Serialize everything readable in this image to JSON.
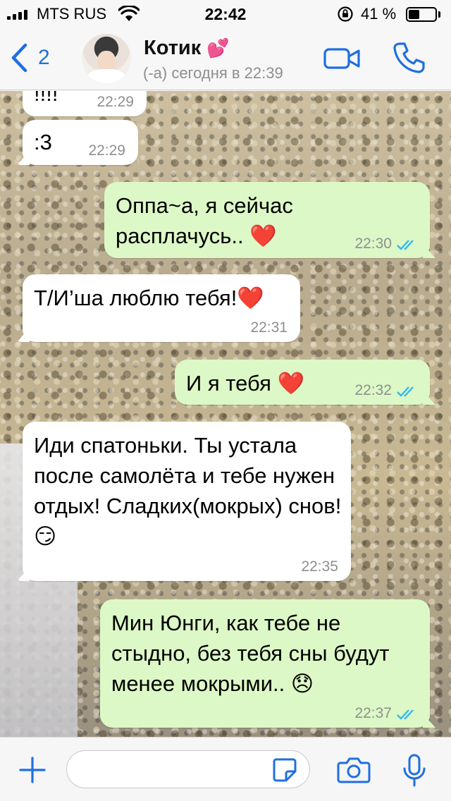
{
  "status_bar": {
    "carrier": "MTS RUS",
    "time": "22:42",
    "battery_percent": "41 %",
    "battery_level": 0.41
  },
  "header": {
    "back_count": "2",
    "contact_name": "Котик",
    "name_emoji": "💕",
    "last_seen": "(-а) сегодня в 22:39"
  },
  "messages": [
    {
      "direction": "in",
      "text": "!!!!",
      "time": "22:29"
    },
    {
      "direction": "in",
      "text": ":3",
      "time": "22:29"
    },
    {
      "direction": "out",
      "text": "Оппа~а, я сейчас расплачусь.. ❤️",
      "time": "22:30",
      "status": "read"
    },
    {
      "direction": "in",
      "text": "Т/И’ша люблю тебя!❤️",
      "time": "22:31"
    },
    {
      "direction": "out",
      "text": "И я тебя ❤️",
      "time": "22:32",
      "status": "read"
    },
    {
      "direction": "in",
      "text": "Иди спатоньки. Ты устала после самолёта и тебе нужен отдых! Сладких(мокрых) снов!😏",
      "time": "22:35"
    },
    {
      "direction": "out",
      "text": "Мин Юнги, как тебе не стыдно, без тебя сны будут менее мокрыми.. 😞",
      "time": "22:37",
      "status": "read"
    }
  ],
  "input": {
    "placeholder": ""
  },
  "colors": {
    "accent": "#1f6fe0",
    "outgoing_bubble": "#dcf8c6",
    "incoming_bubble": "#ffffff",
    "read_ticks": "#34b7f1"
  },
  "icons": {
    "back": "chevron-left-icon",
    "video": "video-camera-icon",
    "call": "phone-icon",
    "attach": "plus-icon",
    "sticker": "sticker-icon",
    "camera": "camera-icon",
    "mic": "microphone-icon"
  }
}
